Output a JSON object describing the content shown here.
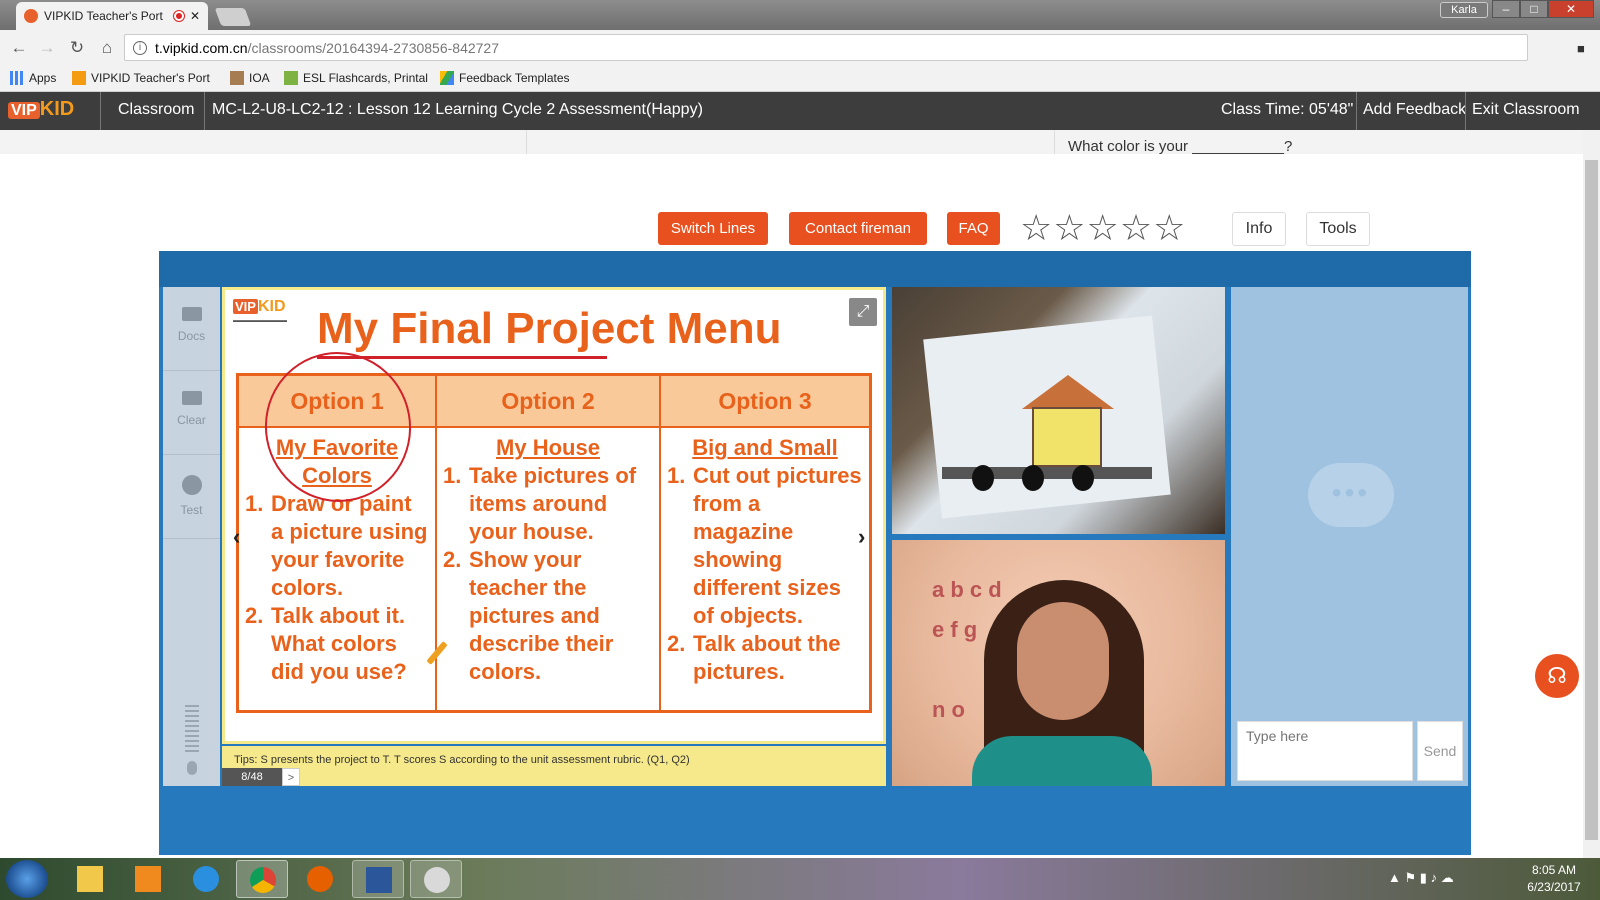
{
  "browser": {
    "tab_title": "VIPKID Teacher's Port",
    "user_badge": "Karla",
    "url_host": "t.vipkid.com.cn",
    "url_path": "/classrooms/20164394-2730856-842727",
    "bookmarks": [
      {
        "label": "Apps"
      },
      {
        "label": "VIPKID Teacher's Port"
      },
      {
        "label": "IOA"
      },
      {
        "label": "ESL Flashcards, Printal"
      },
      {
        "label": "Feedback Templates"
      }
    ]
  },
  "classroom_header": {
    "logo": "VIPKID",
    "classroom_label": "Classroom",
    "lesson_title": "MC-L2-U8-LC2-12 : Lesson 12 Learning Cycle 2 Assessment(Happy)",
    "class_time": "Class Time: 05'48\"",
    "add_feedback": "Add Feedback",
    "exit_classroom": "Exit Classroom",
    "hint_text": "What color is your ___________?"
  },
  "toolbar": {
    "switch_lines": "Switch Lines",
    "contact_fireman": "Contact fireman",
    "faq": "FAQ",
    "stars": "☆☆☆☆☆",
    "rating_stars_filled": 0,
    "rating_stars_total": 5,
    "info": "Info",
    "tools": "Tools"
  },
  "side_tools": [
    {
      "label": "Docs"
    },
    {
      "label": "Clear"
    },
    {
      "label": "Test"
    }
  ],
  "slide": {
    "logo": "VIPKID",
    "title": "My Final Project Menu",
    "columns": [
      {
        "head": "Option 1",
        "subtitle": "My Favorite Colors",
        "steps": [
          {
            "n": "1.",
            "text": "Draw or paint a picture using your favorite colors."
          },
          {
            "n": "2.",
            "text": "Talk about it. What colors did you use?"
          }
        ]
      },
      {
        "head": "Option 2",
        "subtitle": "My House",
        "steps": [
          {
            "n": "1.",
            "text": "Take pictures of items around your house."
          },
          {
            "n": "2.",
            "text": "Show your teacher the pictures and describe their colors."
          }
        ]
      },
      {
        "head": "Option 3",
        "subtitle": "Big and Small",
        "steps": [
          {
            "n": "1.",
            "text": "Cut out pictures from a magazine showing different sizes of objects."
          },
          {
            "n": "2.",
            "text": "Talk about the pictures."
          }
        ]
      }
    ],
    "nav_prev": "‹",
    "nav_next": "›"
  },
  "tips": {
    "text": "Tips: S presents the project to T. T scores S according to the unit assessment rubric. (Q1, Q2)",
    "page_counter": "8/48",
    "next": ">"
  },
  "chat": {
    "input_placeholder": "Type here",
    "send": "Send"
  },
  "taskbar": {
    "time": "8:05 AM",
    "date": "6/23/2017"
  },
  "colors": {
    "accent_orange": "#e8501f",
    "slide_orange": "#e8621c",
    "stage_blue": "#2679bd",
    "chat_blue": "#9fc2e0",
    "header_dark": "#3d3d3d"
  }
}
